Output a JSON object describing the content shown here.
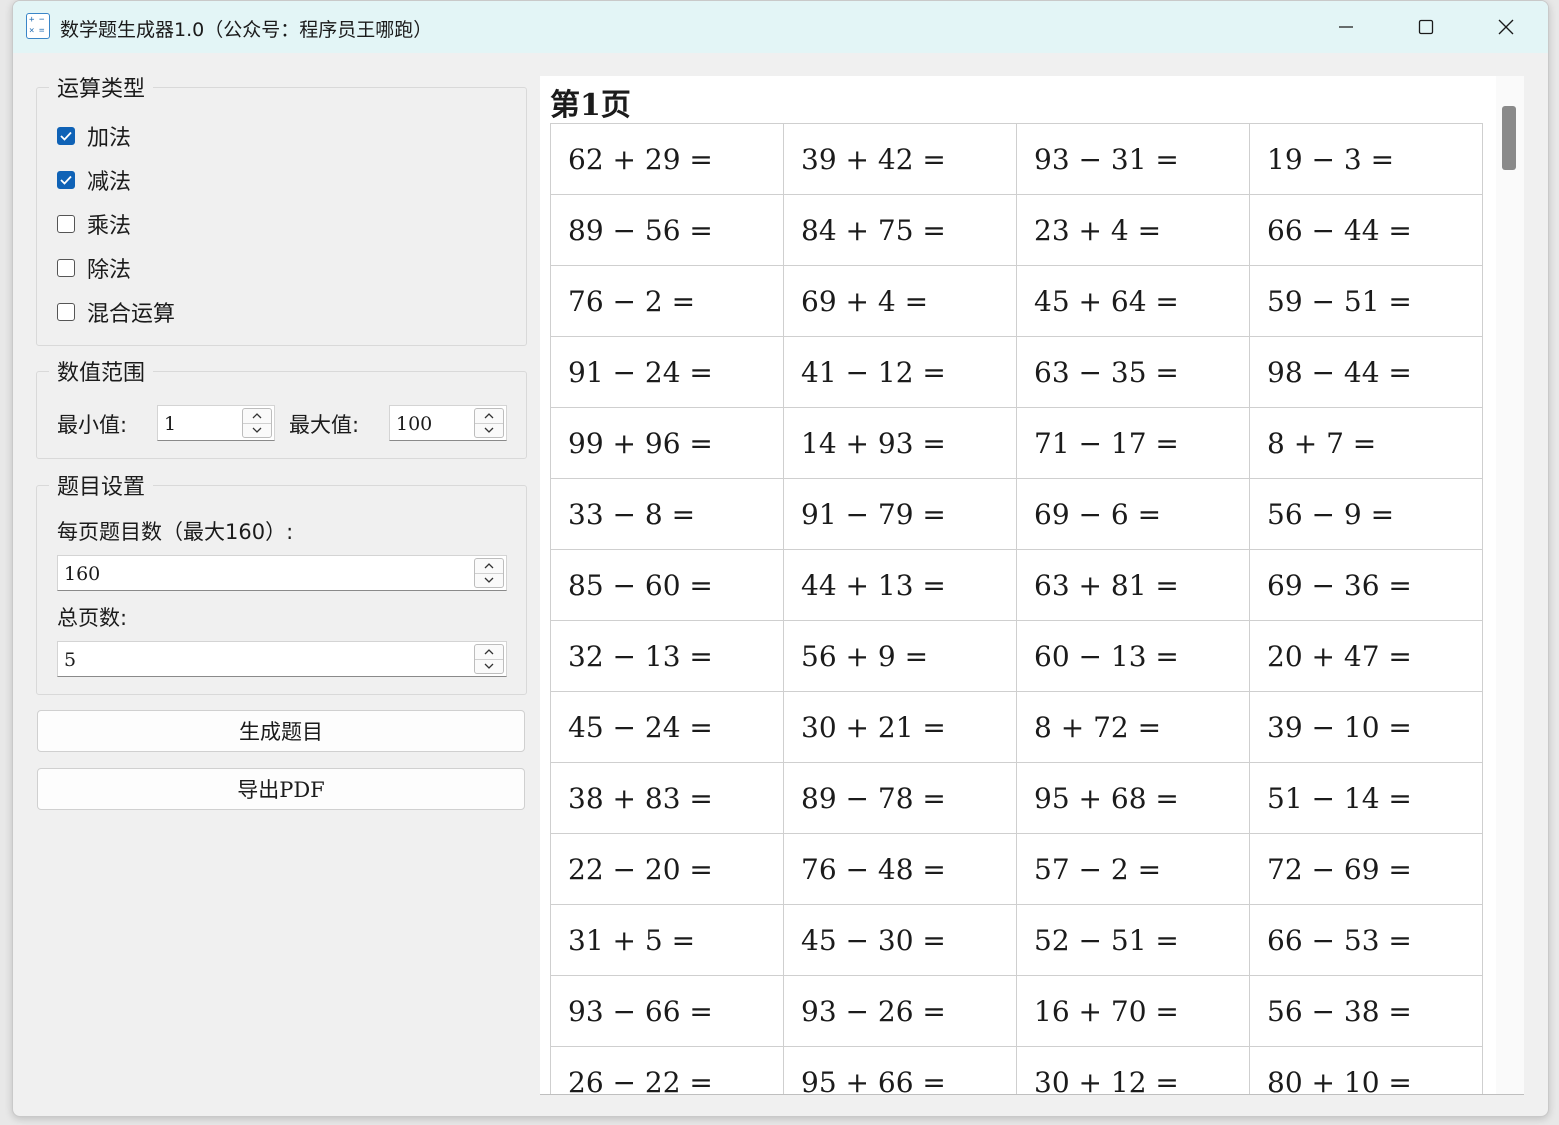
{
  "window": {
    "title": "数学题生成器1.0（公众号：程序员王哪跑）",
    "icon_glyphs": [
      "+",
      "−",
      "×",
      "="
    ]
  },
  "operation_group": {
    "title": "运算类型",
    "options": [
      {
        "label": "加法",
        "checked": true
      },
      {
        "label": "减法",
        "checked": true
      },
      {
        "label": "乘法",
        "checked": false
      },
      {
        "label": "除法",
        "checked": false
      },
      {
        "label": "混合运算",
        "checked": false
      }
    ]
  },
  "range_group": {
    "title": "数值范围",
    "min_label": "最小值:",
    "min_value": "1",
    "max_label": "最大值:",
    "max_value": "100"
  },
  "question_group": {
    "title": "题目设置",
    "per_page_label": "每页题目数（最大160）:",
    "per_page_value": "160",
    "total_pages_label": "总页数:",
    "total_pages_value": "5"
  },
  "actions": {
    "generate_label": "生成题目",
    "export_label": "导出PDF"
  },
  "preview": {
    "page_title": "第1页",
    "rows": [
      [
        "62 + 29 =",
        "39 + 42 =",
        "93 − 31 =",
        "19 − 3 ="
      ],
      [
        "89 − 56 =",
        "84 + 75 =",
        "23 + 4 =",
        "66 − 44 ="
      ],
      [
        "76 − 2 =",
        "69 + 4 =",
        "45 + 64 =",
        "59 − 51 ="
      ],
      [
        "91 − 24 =",
        "41 − 12 =",
        "63 − 35 =",
        "98 − 44 ="
      ],
      [
        "99 + 96 =",
        "14 + 93 =",
        "71 − 17 =",
        "8 + 7 ="
      ],
      [
        "33 − 8 =",
        "91 − 79 =",
        "69 − 6 =",
        "56 − 9 ="
      ],
      [
        "85 − 60 =",
        "44 + 13 =",
        "63 + 81 =",
        "69 − 36 ="
      ],
      [
        "32 − 13 =",
        "56 + 9 =",
        "60 − 13 =",
        "20 + 47 ="
      ],
      [
        "45 − 24 =",
        "30 + 21 =",
        "8 + 72 =",
        "39 − 10 ="
      ],
      [
        "38 + 83 =",
        "89 − 78 =",
        "95 + 68 =",
        "51 − 14 ="
      ],
      [
        "22 − 20 =",
        "76 − 48 =",
        "57 − 2 =",
        "72 − 69 ="
      ],
      [
        "31 + 5 =",
        "45 − 30 =",
        "52 − 51 =",
        "66 − 53 ="
      ],
      [
        "93 − 66 =",
        "93 − 26 =",
        "16 + 70 =",
        "56 − 38 ="
      ],
      [
        "26 − 22 =",
        "95 + 66 =",
        "30 + 12 =",
        "80 + 10 ="
      ]
    ]
  },
  "colors": {
    "titlebar": "#e3f5f6",
    "checkbox_accent": "#0f62b6",
    "window_bg": "#f0f0f0"
  }
}
